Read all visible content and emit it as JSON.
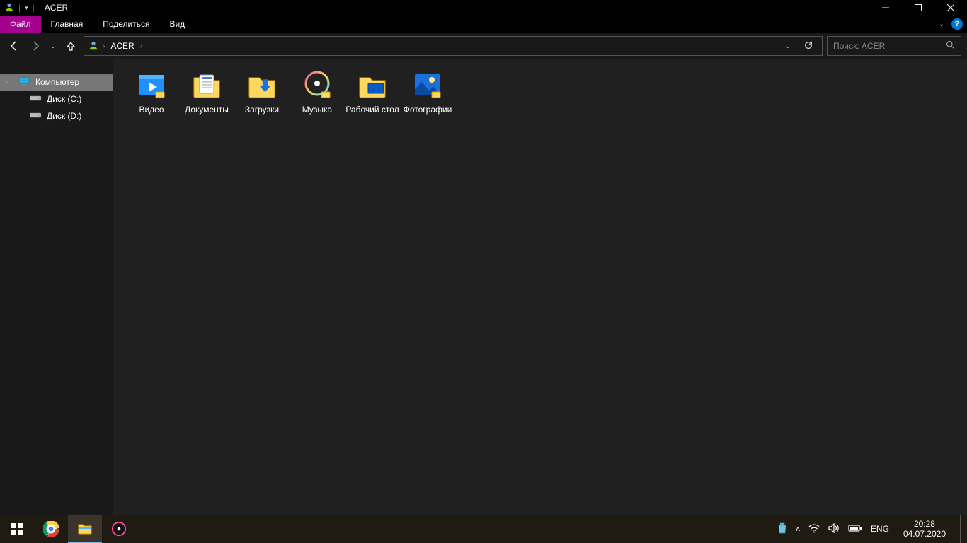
{
  "window": {
    "title": "ACER"
  },
  "menu": {
    "file": "Файл",
    "home": "Главная",
    "share": "Поделиться",
    "view": "Вид"
  },
  "address": {
    "crumb1": "ACER",
    "refresh_title": "Обновить"
  },
  "search": {
    "placeholder": "Поиск: ACER"
  },
  "sidebar": {
    "items": [
      {
        "label": "Компьютер",
        "type": "computer",
        "selected": true
      },
      {
        "label": "Диск (C:)",
        "type": "drive"
      },
      {
        "label": "Диск (D:)",
        "type": "drive"
      }
    ]
  },
  "folders": [
    {
      "label": "Видео",
      "kind": "videos"
    },
    {
      "label": "Документы",
      "kind": "documents"
    },
    {
      "label": "Загрузки",
      "kind": "downloads"
    },
    {
      "label": "Музыка",
      "kind": "music"
    },
    {
      "label": "Рабочий стол",
      "kind": "desktop"
    },
    {
      "label": "Фотографии",
      "kind": "pictures"
    }
  ],
  "tray": {
    "lang": "ENG",
    "time": "20:28",
    "date": "04.07.2020"
  }
}
